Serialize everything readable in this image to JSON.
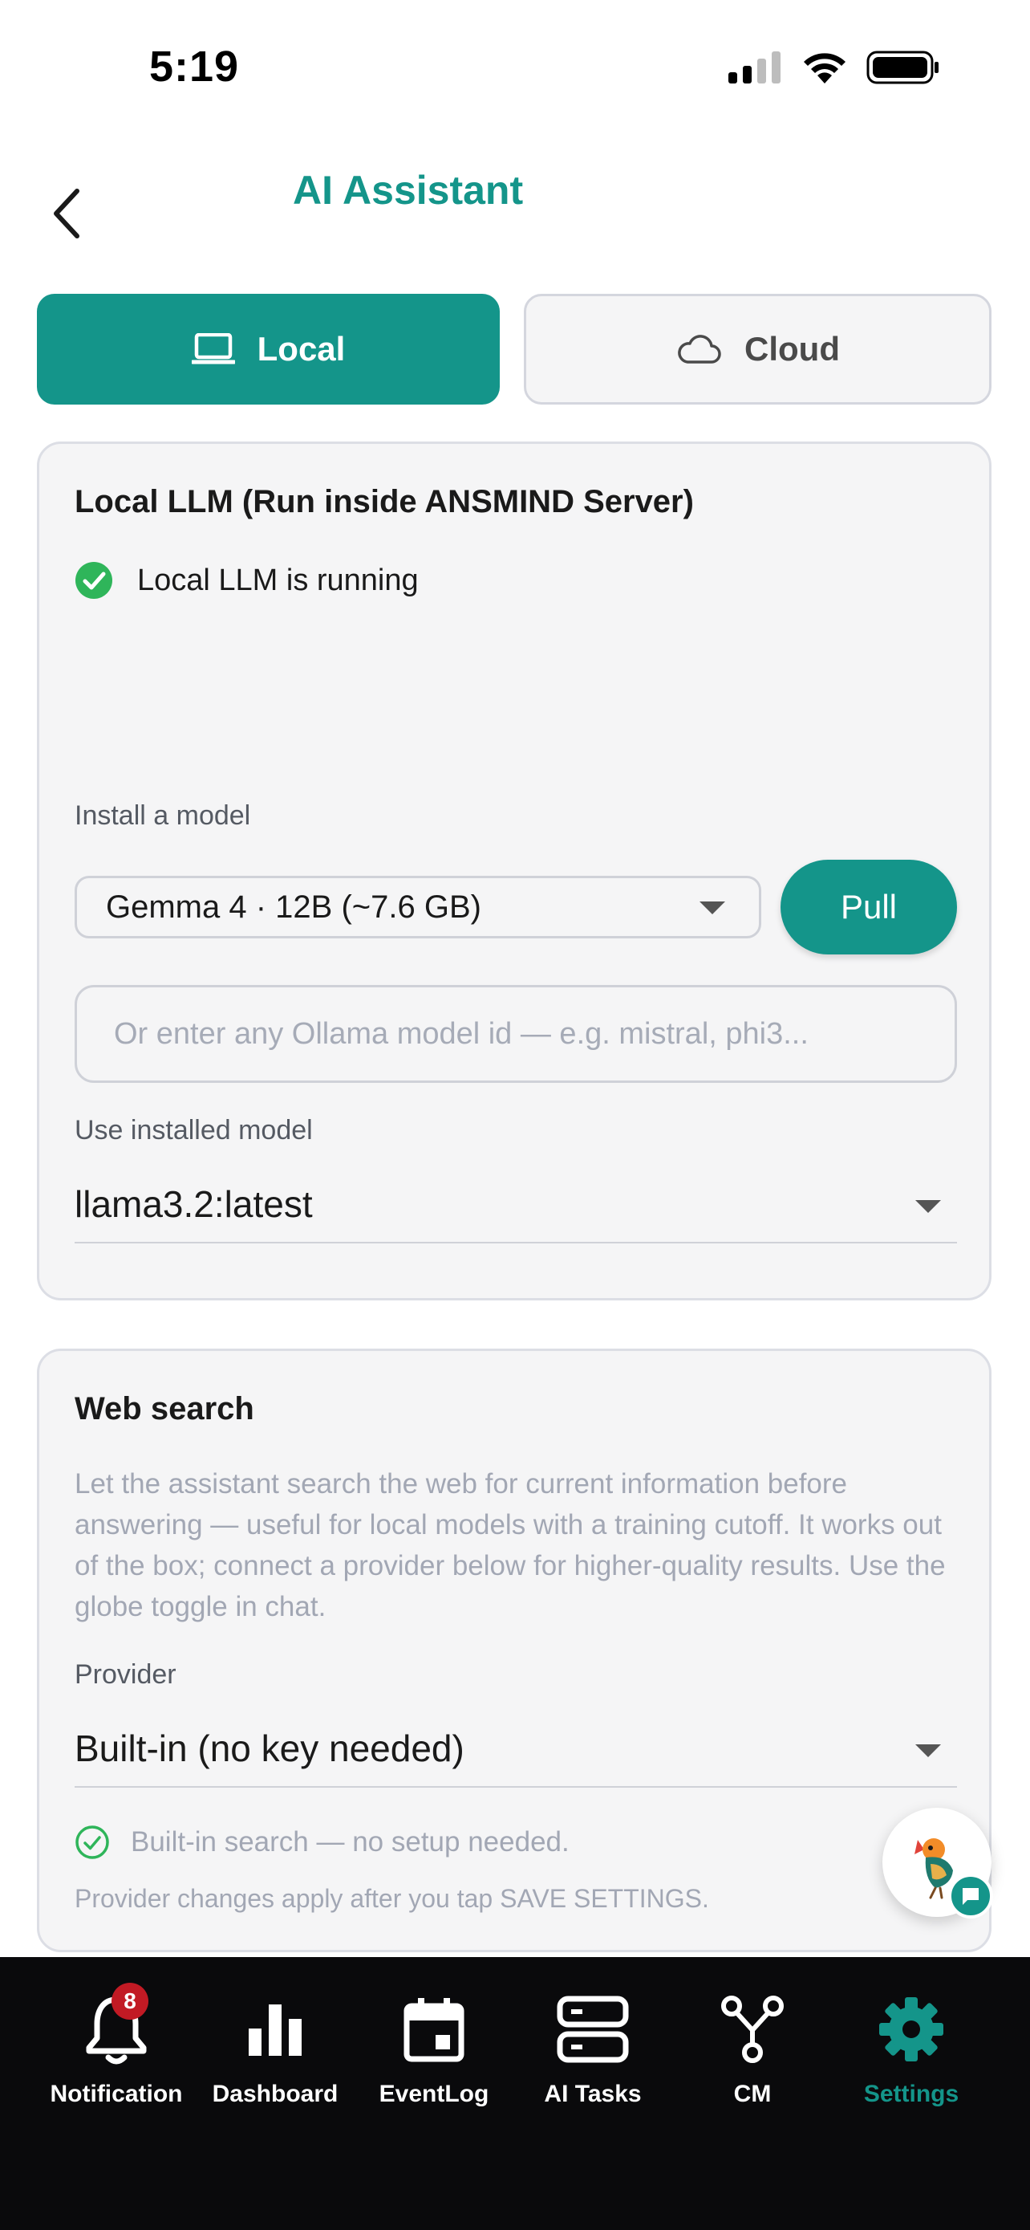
{
  "status_bar": {
    "time": "5:19"
  },
  "header": {
    "title": "AI Assistant"
  },
  "mode_tabs": {
    "local_label": "Local",
    "cloud_label": "Cloud",
    "selected": "Local"
  },
  "local_card": {
    "title": "Local LLM (Run inside ANSMIND Server)",
    "status_text": "Local LLM is running",
    "install_label": "Install a model",
    "selected_model": "Gemma 4 · 12B (~7.6 GB)",
    "pull_label": "Pull",
    "model_id_placeholder": "Or enter any Ollama model id — e.g. mistral, phi3...",
    "model_id_value": "",
    "installed_label": "Use installed model",
    "installed_model": "llama3.2:latest"
  },
  "web_card": {
    "title": "Web search",
    "description": "Let the assistant search the web for current information before answering — useful for local models with a training cutoff. It works out of the box; connect a provider below for higher-quality results. Use the globe toggle in chat.",
    "provider_label": "Provider",
    "provider_value": "Built-in (no key needed)",
    "builtin_note": "Built-in search — no setup needed.",
    "provider_changes_note": "Provider changes apply after you tap SAVE SETTINGS."
  },
  "bottom_nav": {
    "items": [
      {
        "label": "Notification",
        "icon": "bell-icon",
        "badge": "8"
      },
      {
        "label": "Dashboard",
        "icon": "bar-chart-icon"
      },
      {
        "label": "EventLog",
        "icon": "calendar-icon"
      },
      {
        "label": "AI Tasks",
        "icon": "server-icon"
      },
      {
        "label": "CM",
        "icon": "branch-icon"
      },
      {
        "label": "Settings",
        "icon": "gear-icon"
      }
    ],
    "active": "Settings"
  },
  "colors": {
    "accent": "#14958a",
    "badge": "#c21a24",
    "nav_background": "#0a0a0c",
    "card_background": "#f5f5f6",
    "success": "#2fb55a"
  }
}
